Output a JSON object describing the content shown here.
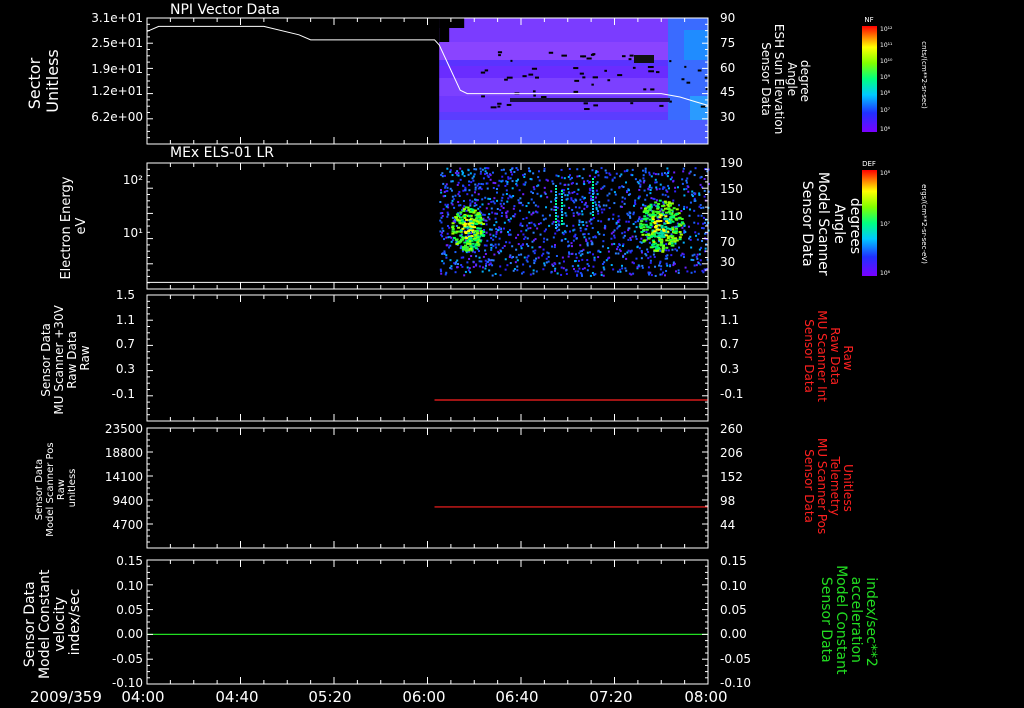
{
  "date_label": "2009/359",
  "time_ticks": [
    "04:00",
    "04:40",
    "05:20",
    "06:00",
    "06:40",
    "07:20",
    "08:00"
  ],
  "colors": {
    "axis": "#ffffff",
    "red_trace": "#ff2020",
    "green_trace": "#22dd22",
    "background": "#000000"
  },
  "colorbars": [
    {
      "label": "NF",
      "unit": "cnts/(cm**2-sr-sec)",
      "ticks": [
        "10¹²",
        "10¹¹",
        "10¹⁰",
        "10⁹",
        "10⁸",
        "10⁷",
        "10⁶"
      ]
    },
    {
      "label": "DEF",
      "unit": "ergs/(cm**2-sr-sec-eV)",
      "ticks": [
        "10⁸",
        "10⁷",
        "10⁶"
      ]
    }
  ],
  "chart_data": [
    {
      "type": "heatmap",
      "panel": "npi",
      "title": "NPI Vector Data",
      "left_label": [
        "Sector",
        "Unitless"
      ],
      "right_label": [
        "Sensor Data",
        "ESH Sun Elevation",
        "Angle",
        "degree"
      ],
      "left_ticks": [
        "3.1e+01",
        "2.5e+01",
        "1.9e+01",
        "1.2e+01",
        "6.2e+00"
      ],
      "right_ticks": [
        "90",
        "75",
        "60",
        "45",
        "30"
      ],
      "xlim": [
        "04:00",
        "08:00"
      ],
      "data_start": "06:05",
      "ylim_right": [
        15,
        90
      ],
      "overlay_line": {
        "x": [
          "04:00",
          "04:05",
          "04:50",
          "05:05",
          "05:10",
          "06:00",
          "06:03",
          "06:05",
          "06:08",
          "06:14",
          "06:17",
          "07:40",
          "07:48",
          "07:55",
          "08:00"
        ],
        "y": [
          82,
          85,
          85,
          80,
          77,
          77,
          77,
          74,
          65,
          47,
          45,
          45,
          43,
          40,
          38
        ]
      }
    },
    {
      "type": "heatmap",
      "panel": "els",
      "title": "MEx ELS-01 LR",
      "left_label": [
        "Electron Energy",
        "eV"
      ],
      "right_label": [
        "Sensor Data",
        "Model Scanner",
        "Angle",
        "degrees"
      ],
      "left_ticks": [
        "10²",
        "10¹"
      ],
      "right_ticks": [
        "190",
        "150",
        "110",
        "70",
        "30"
      ],
      "xlim": [
        "04:00",
        "08:00"
      ],
      "data_start": "06:05",
      "ylim_right": [
        0,
        190
      ],
      "overlay_line": {
        "x": [
          "04:00",
          "08:00"
        ],
        "y": [
          10,
          10
        ]
      }
    },
    {
      "type": "line",
      "panel": "mu_raw",
      "left_label": [
        "Sensor Data",
        "MU Scanner +30V",
        "Raw Data",
        "Raw"
      ],
      "right_label": [
        "Sensor Data",
        "MU Scanner Int",
        "Raw Data",
        "Raw"
      ],
      "left_ticks": [
        "1.5",
        "1.1",
        "0.7",
        "0.3",
        "-0.1"
      ],
      "right_ticks": [
        "1.5",
        "1.1",
        "0.7",
        "0.3",
        "-0.1"
      ],
      "ylim": [
        -0.3,
        1.5
      ],
      "series": [
        {
          "x": [
            "06:03",
            "08:00"
          ],
          "y": [
            0.0,
            0.0
          ]
        }
      ]
    },
    {
      "type": "line",
      "panel": "mu_pos",
      "left_label": [
        "Sensor Data",
        "Model Scanner Pos",
        "Raw",
        "unitless"
      ],
      "right_label": [
        "Sensor Data",
        "MU Scanner Pos",
        "Telemetry",
        "Unitless"
      ],
      "left_ticks": [
        "23500",
        "18800",
        "14100",
        "9400",
        "4700"
      ],
      "right_ticks": [
        "260",
        "206",
        "152",
        "98",
        "44"
      ],
      "ylim_left": [
        0,
        23500
      ],
      "ylim_right": [
        0,
        260
      ],
      "series": [
        {
          "x": [
            "06:03",
            "08:00"
          ],
          "y_right": [
            89,
            89
          ]
        }
      ]
    },
    {
      "type": "line",
      "panel": "model",
      "left_label": [
        "Sensor Data",
        "Model Constant",
        "velocity",
        "index/sec"
      ],
      "right_label": [
        "Sensor Data",
        "Model Constant",
        "acceleration",
        "index/sec**2"
      ],
      "left_ticks": [
        "0.15",
        "0.10",
        "0.05",
        "0.00",
        "-0.05",
        "-0.10"
      ],
      "right_ticks": [
        "0.15",
        "0.10",
        "0.05",
        "0.00",
        "-0.05",
        "-0.10"
      ],
      "ylim": [
        -0.1,
        0.15
      ],
      "series": [
        {
          "x": [
            "04:00",
            "08:00"
          ],
          "y": [
            0.0,
            0.0
          ]
        }
      ]
    }
  ]
}
